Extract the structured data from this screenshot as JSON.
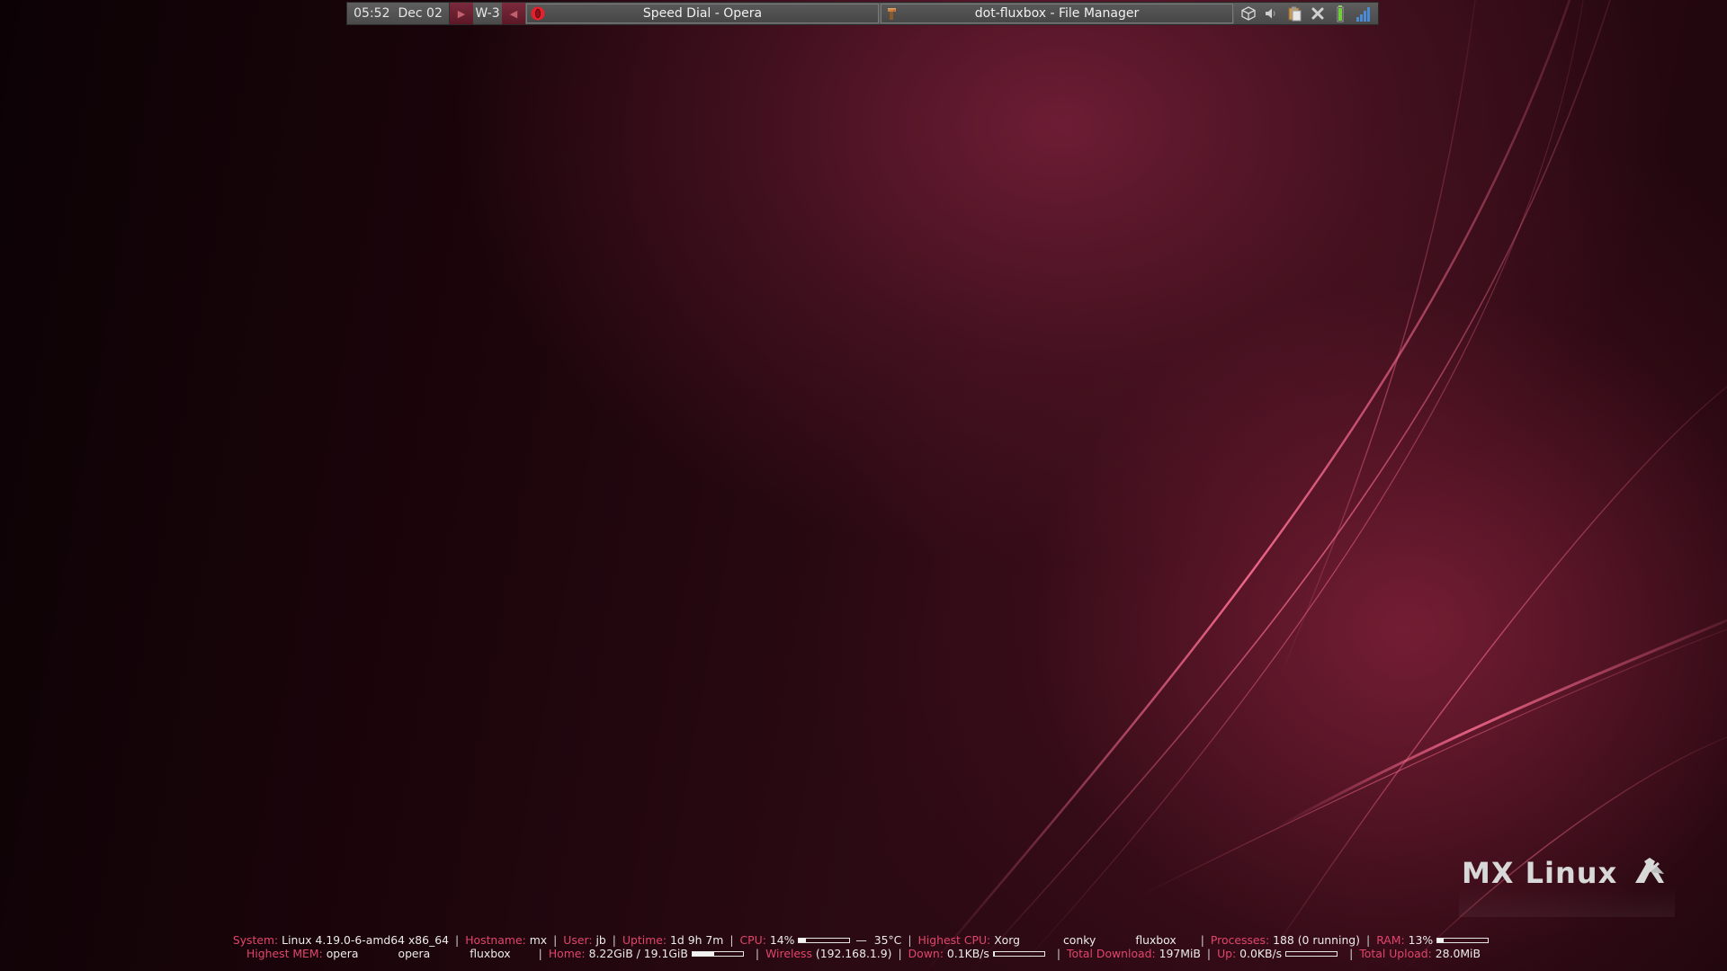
{
  "toolbar": {
    "time": "05:52",
    "date": "Dec 02",
    "workspace_next_icon": "play-right-arrow",
    "workspace": "W-3",
    "workspace_prev_icon": "play-left-arrow",
    "tasks": [
      {
        "title": "Speed Dial - Opera",
        "icon": "opera-icon"
      },
      {
        "title": "dot-fluxbox - File Manager",
        "icon": "file-manager-icon"
      }
    ],
    "tray_icons": [
      "package-box-icon",
      "volume-icon",
      "clipboard-icon",
      "close-x-icon",
      "battery-icon",
      "network-signal-icon"
    ]
  },
  "logo": {
    "text": "MX Linux"
  },
  "conky": {
    "system_label": "System:",
    "system_value": "Linux 4.19.0-6-amd64 x86_64",
    "hostname_label": "Hostname:",
    "hostname_value": "mx",
    "user_label": "User:",
    "user_value": "jb",
    "uptime_label": "Uptime:",
    "uptime_value": "1d 9h 7m",
    "cpu_label": "CPU:",
    "cpu_value": "14%",
    "cpu_fraction": 0.14,
    "temp_prefix": "—",
    "temp_value": "35°C",
    "highest_cpu_label": "Highest CPU:",
    "highest_cpu": [
      "Xorg",
      "conky",
      "fluxbox"
    ],
    "processes_label": "Processes:",
    "processes_value": "188 (0 running)",
    "ram_label": "RAM:",
    "ram_value": "13%",
    "ram_fraction": 0.13,
    "highest_mem_label": "Highest MEM:",
    "highest_mem": [
      "opera",
      "opera",
      "fluxbox"
    ],
    "home_label": "Home:",
    "home_value": "8.22GiB / 19.1GiB",
    "home_fraction": 0.43,
    "wireless_label": "Wireless",
    "wireless_value": "(192.168.1.9)",
    "down_label": "Down:",
    "down_value": "0.1KB/s",
    "down_fraction": 0.01,
    "total_download_label": "Total Download:",
    "total_download_value": "197MiB",
    "up_label": "Up:",
    "up_value": "0.0KB/s",
    "up_fraction": 0.0,
    "total_upload_label": "Total Upload:",
    "total_upload_value": "28.0MiB",
    "separator": "|"
  },
  "colors": {
    "conky_label": "#e2456c",
    "conky_value": "#ececec",
    "toolbar_bg": "#5b5b5b",
    "workspace_arrow": "#7a2a3c",
    "wallpaper_accent": "#d8486e"
  }
}
